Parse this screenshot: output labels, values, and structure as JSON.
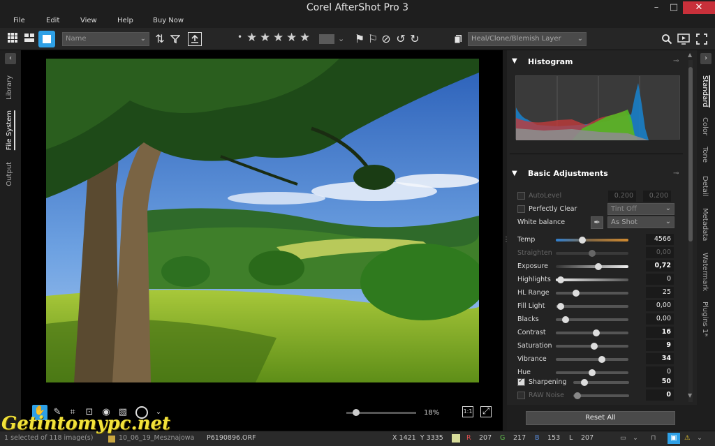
{
  "app": {
    "title": "Corel AfterShot Pro 3"
  },
  "window": {
    "minimize_label": "–",
    "maximize_label": "□",
    "close_label": "✕"
  },
  "menu": {
    "items": [
      "File",
      "Edit",
      "View",
      "Help",
      "Buy Now"
    ]
  },
  "toolbar": {
    "sort_select": "Name",
    "layer_select": "Heal/Clone/Blemish Layer",
    "rating_dot": "•",
    "stars": [
      "★",
      "★",
      "★",
      "★",
      "★"
    ]
  },
  "left_tabs": [
    "Library",
    "File System",
    "Output"
  ],
  "left_tabs_active": "File System",
  "right_tabs": [
    "Standard",
    "Color",
    "Tone",
    "Detail",
    "Metadata",
    "Watermark",
    "Plugins 1*"
  ],
  "right_tabs_active": "Standard",
  "histogram": {
    "title": "Histogram"
  },
  "basic": {
    "title": "Basic Adjustments",
    "autolevel": {
      "label": "AutoLevel",
      "v1": "0.200",
      "v2": "0.200"
    },
    "perfectly_clear": {
      "label": "Perfectly Clear",
      "select": "Tint Off"
    },
    "white_balance": {
      "label": "White balance",
      "select": "As Shot"
    },
    "sliders": [
      {
        "label": "Temp",
        "value": "4566",
        "pos": 0.35,
        "dim": false,
        "bold": false
      },
      {
        "label": "Straighten",
        "value": "0,00",
        "pos": 0.5,
        "dim": true,
        "bold": false
      },
      {
        "label": "Exposure",
        "value": "0,72",
        "pos": 0.6,
        "dim": false,
        "bold": true
      },
      {
        "label": "Highlights",
        "value": "0",
        "pos": 0.02,
        "dim": false,
        "bold": false
      },
      {
        "label": "HL Range",
        "value": "25",
        "pos": 0.25,
        "dim": false,
        "bold": false
      },
      {
        "label": "Fill Light",
        "value": "0,00",
        "pos": 0.02,
        "dim": false,
        "bold": false
      },
      {
        "label": "Blacks",
        "value": "0,00",
        "pos": 0.1,
        "dim": false,
        "bold": false
      },
      {
        "label": "Contrast",
        "value": "16",
        "pos": 0.56,
        "dim": false,
        "bold": true
      },
      {
        "label": "Saturation",
        "value": "9",
        "pos": 0.53,
        "dim": false,
        "bold": true
      },
      {
        "label": "Vibrance",
        "value": "34",
        "pos": 0.65,
        "dim": false,
        "bold": true
      },
      {
        "label": "Hue",
        "value": "0",
        "pos": 0.5,
        "dim": false,
        "bold": false
      }
    ],
    "sharpening": {
      "label": "Sharpening",
      "value": "50",
      "pos": 0.15
    },
    "raw_noise": {
      "label": "RAW Noise",
      "value": "0",
      "pos": 0.02
    }
  },
  "reset_label": "Reset All",
  "viewer": {
    "zoom": "18%",
    "zoom_level": 0.1
  },
  "status": {
    "selection": "1 selected of 118 image(s)",
    "folder": "10_06_19_Mesznajowa",
    "filename": "P6190896.ORF",
    "coords": "X 1421  Y 3335",
    "r_label": "R",
    "r": "207",
    "g_label": "G",
    "g": "217",
    "b_label": "B",
    "b": "153",
    "l_label": "L",
    "l": "207"
  },
  "watermark_text": "Getintomypc.net",
  "colors": {
    "accent": "#2ea0e6",
    "sample_swatch": "#d7dc9a"
  }
}
